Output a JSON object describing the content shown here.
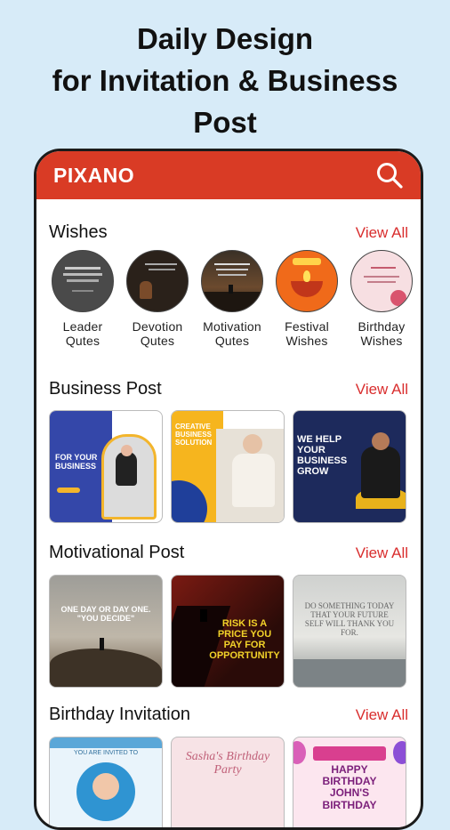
{
  "headline": {
    "line1": "Daily Design",
    "line2": "for Invitation & Business",
    "line3": "Post"
  },
  "app": {
    "brand": "PIXANO",
    "accent": "#d93b25",
    "search_icon": "search-icon"
  },
  "sections": {
    "wishes": {
      "title": "Wishes",
      "view_all": "View All",
      "items": [
        {
          "line1": "Leader",
          "line2": "Qutes"
        },
        {
          "line1": "Devotion",
          "line2": "Qutes"
        },
        {
          "line1": "Motivation",
          "line2": "Qutes"
        },
        {
          "line1": "Festival",
          "line2": "Wishes"
        },
        {
          "line1": "Birthday",
          "line2": "Wishes"
        }
      ]
    },
    "business": {
      "title": "Business Post",
      "view_all": "View All",
      "cards": [
        {
          "text": "FOR YOUR BUSINESS"
        },
        {
          "text": "CREATIVE BUSINESS SOLUTION"
        },
        {
          "text": "WE HELP YOUR BUSINESS GROW"
        }
      ]
    },
    "motivational": {
      "title": "Motivational Post",
      "view_all": "View All",
      "cards": [
        {
          "text": "ONE DAY OR DAY ONE. \"YOU DECIDE\""
        },
        {
          "text": "RISK IS A PRICE YOU PAY FOR OPPORTUNITY"
        },
        {
          "text": "DO SOMETHING TODAY THAT YOUR FUTURE SELF WILL THANK YOU FOR."
        }
      ]
    },
    "birthday": {
      "title": "Birthday Invitation",
      "view_all": "View All",
      "cards": [
        {
          "text": "YOU ARE INVITED TO"
        },
        {
          "text": "Sasha's Birthday Party"
        },
        {
          "text": "HAPPY BIRTHDAY JOHN'S BIRTHDAY"
        }
      ]
    }
  }
}
